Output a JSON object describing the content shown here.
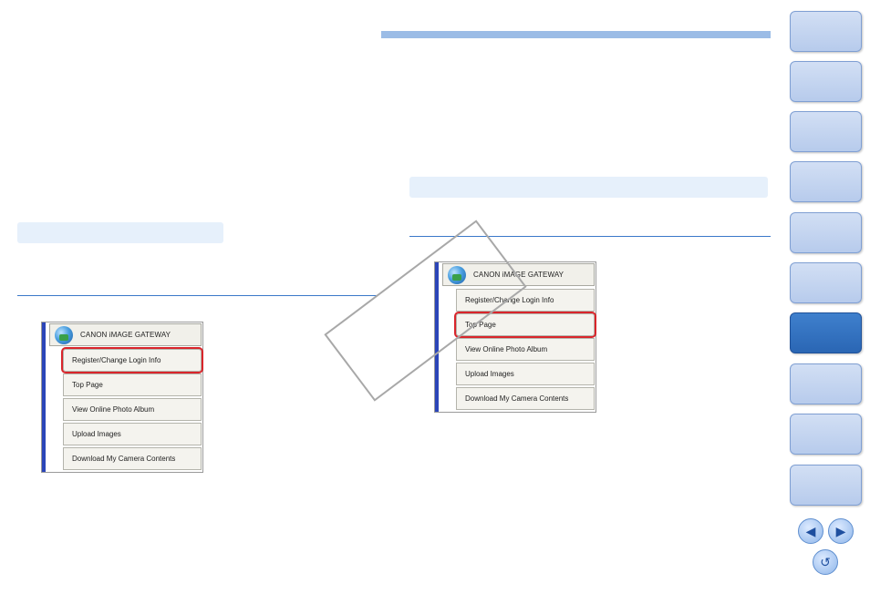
{
  "left_panel": {
    "header": "CANON iMAGE GATEWAY",
    "items": [
      "Register/Change Login Info",
      "Top Page",
      "View Online Photo Album",
      "Upload Images",
      "Download My Camera Contents"
    ],
    "selected_index": 0
  },
  "right_panel": {
    "header": "CANON iMAGE GATEWAY",
    "items": [
      "Register/Change Login Info",
      "Top Page",
      "View Online Photo Album",
      "Upload Images",
      "Download My Camera Contents"
    ],
    "selected_index": 1
  },
  "sidebar": {
    "button_count": 10,
    "active_index": 6
  },
  "nav": {
    "prev_icon": "left-arrow-icon",
    "next_icon": "right-arrow-icon",
    "return_icon": "return-icon"
  }
}
